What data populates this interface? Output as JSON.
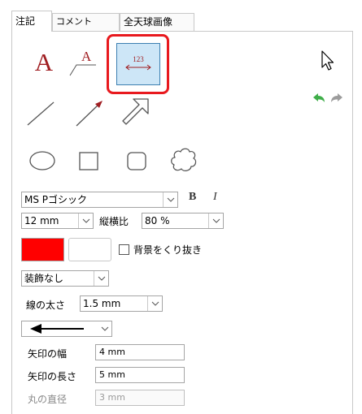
{
  "tabs": [
    {
      "label": "注記"
    },
    {
      "label": "コメント"
    },
    {
      "label": "全天球画像"
    }
  ],
  "tools": {
    "text_a_glyph": "A",
    "leader_text_glyph": "A",
    "dimension_value": "123"
  },
  "font": {
    "family_value": "MS Pゴシック",
    "bold_label": "B",
    "italic_label": "I"
  },
  "size_row": {
    "size_value": "12 mm",
    "aspect_label": "縦横比",
    "aspect_value": "80 %"
  },
  "colors": {
    "text_color": "#ff0000",
    "background_color": "#ffffff",
    "transparent_bg_label": "背景をくり抜き"
  },
  "decoration": {
    "value": "装飾なし"
  },
  "line_width": {
    "label": "線の太さ",
    "value": "1.5 mm"
  },
  "arrow_style": {
    "icon": "left-arrow"
  },
  "arrow_width": {
    "label": "矢印の幅",
    "value": "4 mm"
  },
  "arrow_length": {
    "label": "矢印の長さ",
    "value": "5 mm"
  },
  "circle_diameter": {
    "label": "丸の直径",
    "value": "3 mm"
  },
  "accent": {
    "highlight": "#e8191e",
    "selection_fill": "#cde6f7",
    "undo_green": "#3fae49"
  }
}
